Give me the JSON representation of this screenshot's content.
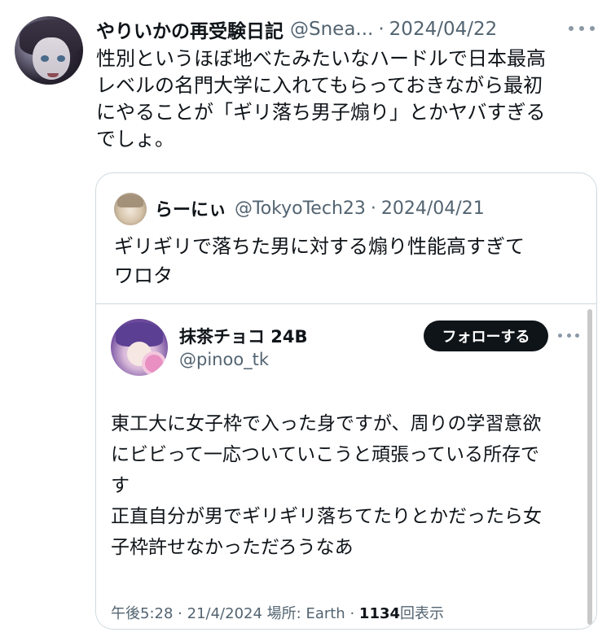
{
  "tweet": {
    "display_name": "やりいかの再受験日記",
    "handle": "@Snea...",
    "separator": "·",
    "date": "2024/04/22",
    "more_icon": "ellipsis-icon",
    "text_lines": [
      "性別というほぼ地べたみたいなハードルで日本最高",
      "レベルの名門大学に入れてもらっておきながら最初",
      "にやることが「ギリ落ち男子煽り」とかヤバすぎる",
      "でしょ。"
    ]
  },
  "quote": {
    "display_name": "らーにぃ",
    "handle": "@TokyoTech23",
    "separator": "·",
    "date": "2024/04/21",
    "text_lines": [
      "ギリギリで落ちた男に対する煽り性能高すぎて",
      "ワロタ"
    ]
  },
  "embed": {
    "display_name": "抹茶チョコ 24B",
    "handle": "@pinoo_tk",
    "follow_label": "フォローする",
    "more_icon": "ellipsis-icon",
    "text_lines": [
      "東工大に女子枠で入った身ですが、周りの学習意欲",
      "にビビって一応ついていこうと頑張っている所存で",
      "す",
      "正直自分が男でギリギリ落ちてたりとかだったら女",
      "子枠許せなかっただろうなあ"
    ],
    "meta": {
      "time": "午後5:28",
      "sep1": "·",
      "date": "21/4/2024",
      "location": "場所: Earth",
      "sep2": "·",
      "views": "1134",
      "views_label": "回表示"
    }
  }
}
